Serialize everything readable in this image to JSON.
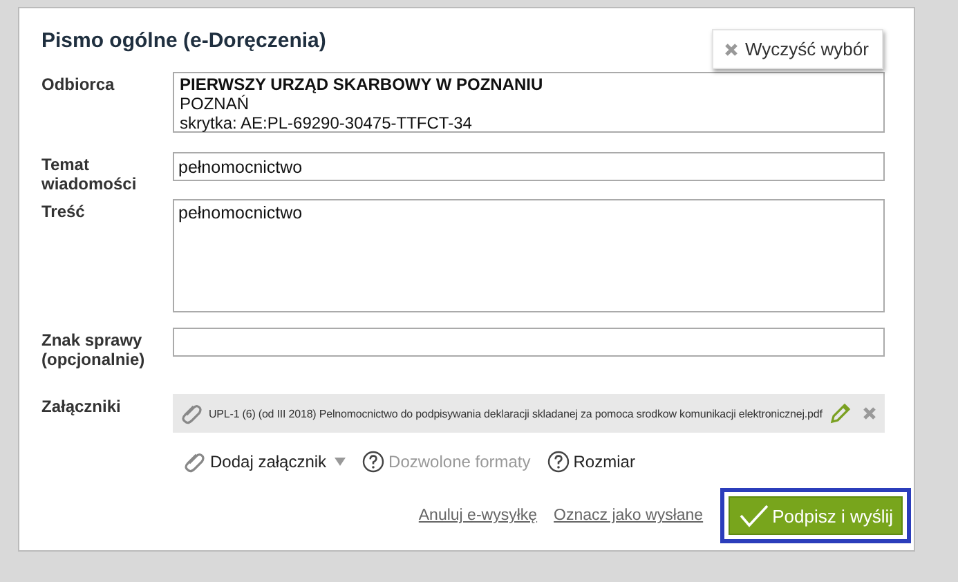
{
  "dialog": {
    "title": "Pismo ogólne (e-Doręczenia)",
    "clear_button": "Wyczyść wybór"
  },
  "fields": [
    {
      "kind": "recipient",
      "label": "Odbiorca",
      "lines": [
        "PIERWSZY URZĄD SKARBOWY W POZNANIU",
        " POZNAŃ",
        "skrytka: AE:PL-69290-30475-TTFCT-34"
      ]
    },
    {
      "kind": "input",
      "label": "Temat wiadomości",
      "value": "pełnomocnictwo"
    },
    {
      "kind": "textarea",
      "label": "Treść",
      "value": "pełnomocnictwo"
    },
    {
      "kind": "input",
      "label": "Znak sprawy (opcjonalnie)"
    },
    {
      "kind": "attachments",
      "label": "Załączniki",
      "files": [
        "UPL-1 (6) (od III 2018) Pelnomocnictwo do podpisywania deklaracji skladanej za pomoca srodkow komunikacji elektronicznej.pdf"
      ]
    }
  ],
  "attachment_tools": [
    {
      "kind": "add",
      "label": "Dodaj załącznik",
      "disabled": false
    },
    {
      "kind": "help",
      "label": "Dozwolone formaty",
      "disabled": true
    },
    {
      "kind": "help",
      "label": "Rozmiar",
      "disabled": false
    }
  ],
  "actions": {
    "links": [
      "Anuluj e-wysyłkę",
      "Oznacz jako wysłane"
    ],
    "submit": {
      "label": "Podpisz i wyślij",
      "focused": true
    }
  }
}
